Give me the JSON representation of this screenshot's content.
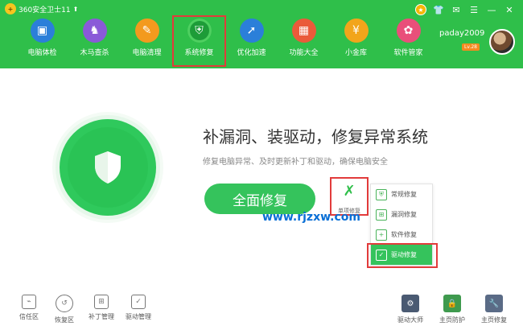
{
  "app": {
    "title": "360安全卫士11",
    "update_arrow": "⬆"
  },
  "window_controls": {
    "star": "★",
    "skin": "👕",
    "mail": "✉",
    "menu": "☰",
    "minimize": "—",
    "close": "✕"
  },
  "nav": [
    {
      "label": "电脑体检",
      "icon": "monitor-icon",
      "glyph": "▣",
      "color": "#2b7fd9"
    },
    {
      "label": "木马查杀",
      "icon": "horse-icon",
      "glyph": "♞",
      "color": "#8a5ad8"
    },
    {
      "label": "电脑清理",
      "icon": "broom-icon",
      "glyph": "✎",
      "color": "#f39a1e"
    },
    {
      "label": "系统修复",
      "icon": "shield-icon",
      "glyph": "⛨",
      "color": "#1d9c38"
    },
    {
      "label": "优化加速",
      "icon": "rocket-icon",
      "glyph": "➚",
      "color": "#2b7fd9"
    },
    {
      "label": "功能大全",
      "icon": "grid-icon",
      "glyph": "▦",
      "color": "#ea5a3a"
    },
    {
      "label": "小金库",
      "icon": "money-bag-icon",
      "glyph": "¥",
      "color": "#f2a51b"
    },
    {
      "label": "软件管家",
      "icon": "apps-icon",
      "glyph": "✿",
      "color": "#e94f7a"
    }
  ],
  "user": {
    "name": "paday2009",
    "level": "Lv.28"
  },
  "main": {
    "headline": "补漏洞、装驱动，修复异常系统",
    "subline": "修复电脑异常、及时更新补丁和驱动，确保电脑安全",
    "repair_button": "全面修复",
    "single_repair_label": "单项修复",
    "single_repair_glyph": "✗",
    "watermark": "www.rjzxw.com"
  },
  "repair_menu": [
    {
      "label": "常规修复",
      "icon": "shield-small-icon",
      "glyph": "⛨"
    },
    {
      "label": "漏洞修复",
      "icon": "windows-icon",
      "glyph": "⊞"
    },
    {
      "label": "软件修复",
      "icon": "plus-box-icon",
      "glyph": "+"
    },
    {
      "label": "驱动修复",
      "icon": "check-box-icon",
      "glyph": "✓"
    }
  ],
  "bottom_left": [
    {
      "label": "信任区",
      "icon": "trust-icon",
      "glyph": "⌁"
    },
    {
      "label": "恢复区",
      "icon": "restore-icon",
      "glyph": "↺"
    },
    {
      "label": "补丁管理",
      "icon": "patch-icon",
      "glyph": "⊞"
    },
    {
      "label": "驱动管理",
      "icon": "driver-icon",
      "glyph": "✓"
    }
  ],
  "bottom_right": [
    {
      "label": "驱动大师",
      "icon": "driver-master-icon",
      "glyph": "⚙"
    },
    {
      "label": "主页防护",
      "icon": "lock-icon",
      "glyph": "🔒"
    },
    {
      "label": "主页修复",
      "icon": "wrench-icon",
      "glyph": "🔧"
    }
  ]
}
